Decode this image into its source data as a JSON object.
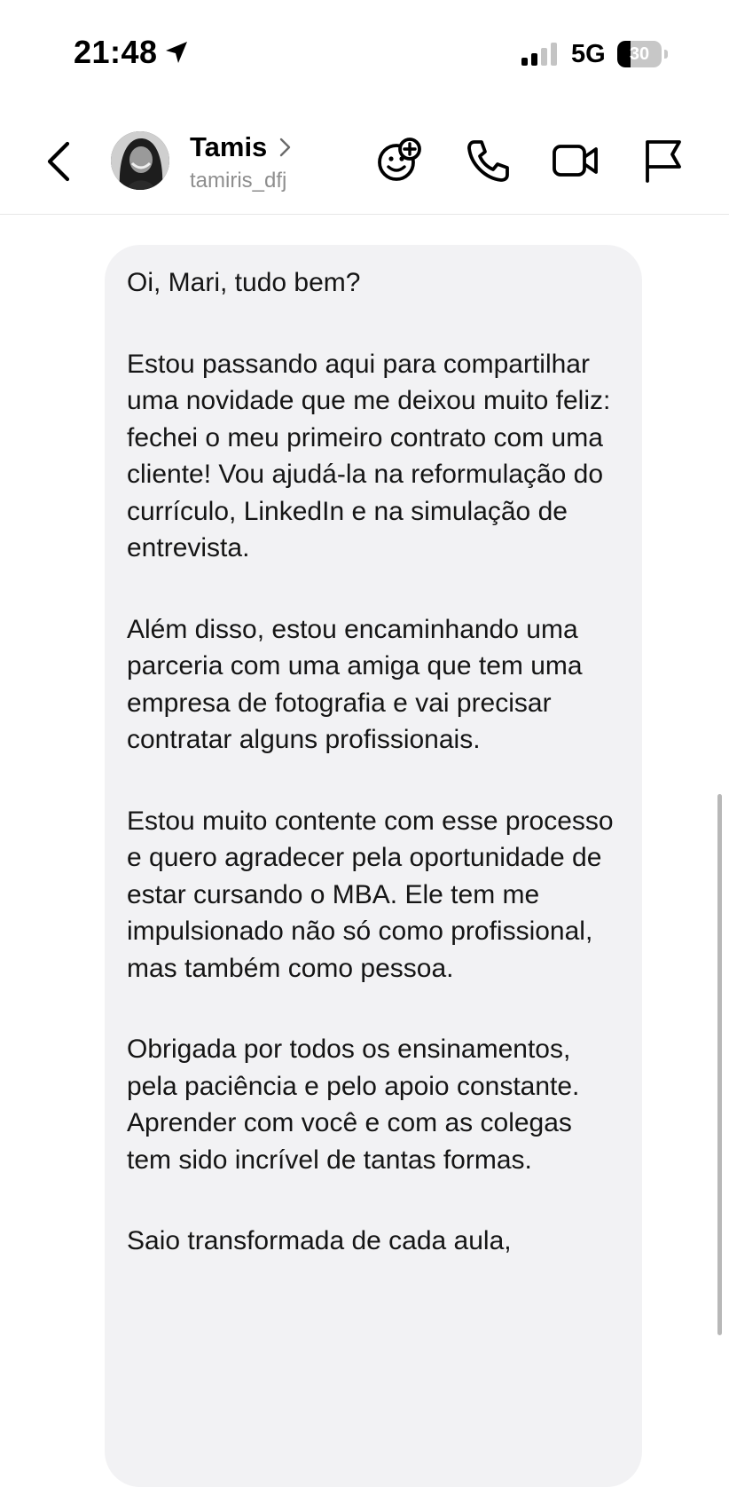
{
  "status_bar": {
    "time": "21:48",
    "network": "5G",
    "battery_level": "30",
    "battery_fraction": 0.3,
    "signal_bars_active": 2,
    "signal_bars_total": 4
  },
  "header": {
    "contact_name": "Tamis",
    "username": "tamiris_dfj",
    "actions": [
      {
        "name": "add-reaction",
        "icon": "smiley-plus-icon"
      },
      {
        "name": "audio-call",
        "icon": "phone-icon"
      },
      {
        "name": "video-call",
        "icon": "video-camera-icon"
      },
      {
        "name": "report",
        "icon": "flag-icon"
      }
    ]
  },
  "message": {
    "paragraphs": [
      "Oi, Mari, tudo bem?",
      "Estou passando aqui para compartilhar uma novidade que me deixou muito feliz: fechei o meu primeiro contrato com uma cliente! Vou ajudá-la na reformulação do currículo, LinkedIn e na simulação de entrevista.",
      "Além disso, estou encaminhando uma parceria com uma amiga que tem uma empresa de fotografia e vai precisar contratar alguns profissionais.",
      "Estou muito contente com esse processo e quero agradecer pela oportunidade de estar cursando o MBA. Ele tem me impulsionado não só como profissional, mas também como pessoa.",
      "Obrigada por todos os ensinamentos, pela paciência e pelo apoio constante. Aprender com você e com as colegas tem sido incrível de tantas formas.",
      "Saio transformada de cada aula,"
    ]
  },
  "colors": {
    "bubble": "#f2f2f4",
    "text": "#151515",
    "secondary_text": "#8e8e8e",
    "divider": "#e6e6e6"
  }
}
